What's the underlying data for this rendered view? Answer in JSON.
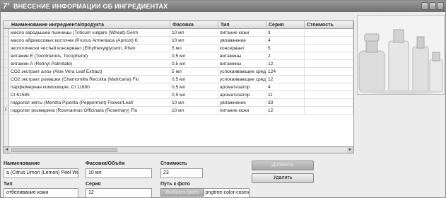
{
  "window": {
    "title": "ВНЕСЕНИЕ ИНФОРМАЦИИ ОБ ИНГРЕДИЕНТАХ",
    "app_icon": "7'"
  },
  "grid": {
    "columns": [
      "Наименование ингредиента/продукта",
      "Фасовка",
      "Тип",
      "Серия",
      "Стоимость"
    ],
    "rows": [
      [
        "масло зародышей пшеницы (Triticum vulgare (Wheat) Germ",
        "10 мл",
        "питание кожи",
        "3",
        ""
      ],
      [
        "масло абрикосовых косточек (Prunus Armeniaca (Apricot) K",
        "10 мл",
        "увлажнение",
        "4",
        ""
      ],
      [
        "экологически чистый консервант (Ethylhexylglycerin, Phen",
        "5 мл",
        "консервант",
        "5",
        ""
      ],
      [
        "витамин E (Tocotrienols, Tocopherol)",
        "0,5 мл",
        "витамины",
        "2",
        ""
      ],
      [
        "витамин A (Retinyl Palmitate)",
        "0,5 мл",
        "витамины",
        "12",
        ""
      ],
      [
        "CO2 экстракт алоэ (Aloe Vera Leaf Extract)",
        "5 мл",
        "успокаивающее средство",
        "124",
        ""
      ],
      [
        "CO2 экстракт ромашки (Chamomilla Recutita (Matricaria) Flo",
        "0,5 мл",
        "успокаивающее средство",
        "12",
        ""
      ],
      [
        "парфюмерная композиция, CI 11680",
        "0,5 мл",
        "ароматизатор",
        "4",
        ""
      ],
      [
        "CI 61585",
        "0,5 мл",
        "ароматизатор",
        "11",
        ""
      ],
      [
        "гидролат мяты (Mentha Piperita (Peppermint) Flower/Leaf/",
        "10 мл",
        "увлажнение",
        "33",
        ""
      ],
      [
        "гидролат розмарина (Rosmarinus Officinalis (Rosemary) Flo",
        "10 мл",
        "питание кожи",
        "12",
        ""
      ]
    ]
  },
  "form": {
    "name_label": "Наименование",
    "name_value": "a (Citrus Limon (Lemon) Peel Water)",
    "package_label": "Фасовка/Объём",
    "package_value": "10 мл",
    "cost_label": "Стоимость",
    "cost_value": "23",
    "type_label": "Тип",
    "type_value": "отбеливание кожи",
    "series_label": "Серия",
    "series_value": "12",
    "photo_path_label": "Путь к фото",
    "photo_path_value": "C:\\IMAGES\\Копия pngtree-color-cosmetics-"
  },
  "buttons": {
    "add_label": "Добавить",
    "delete_label": "Удалить",
    "choose_photo_label": "Выбрать фото"
  },
  "icons": {
    "scroll_left": "arrow-left-icon",
    "scroll_right": "arrow-right-icon",
    "row_marker": "row-pointer-icon"
  }
}
